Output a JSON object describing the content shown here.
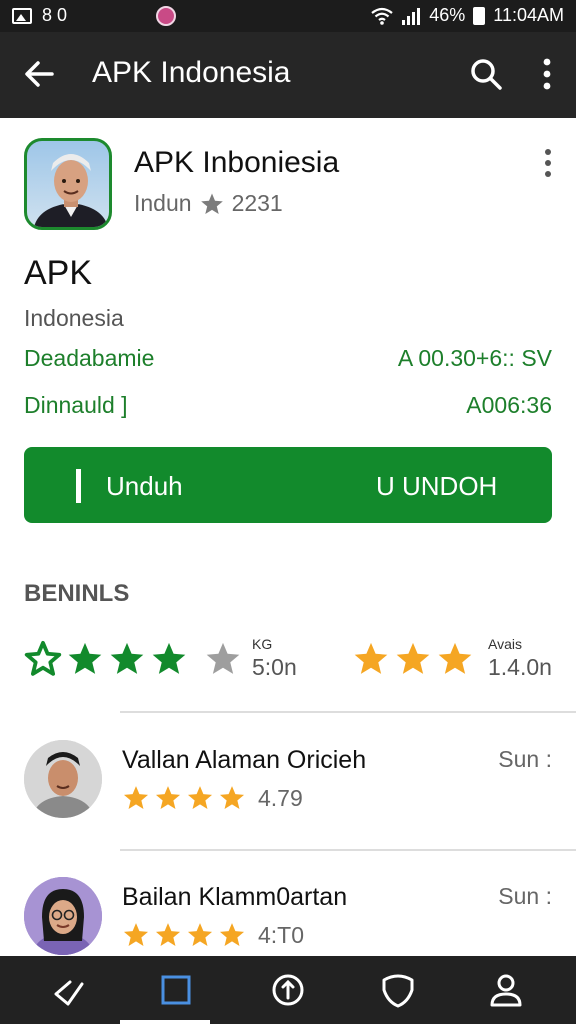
{
  "status_bar": {
    "left_text": "8 0",
    "battery": "46%",
    "time": "11:04AM"
  },
  "app_bar": {
    "title": "APK Indonesia"
  },
  "app": {
    "name": "APK Inboniesia",
    "meta_left": "Indun",
    "meta_right": "2231"
  },
  "heading": {
    "title": "APK",
    "subtitle": "Indonesia"
  },
  "info": [
    {
      "label": "Deadabamie",
      "value": "A 00.30+6:: SV"
    },
    {
      "label": "Dinnauld ]",
      "value": "A006:36"
    }
  ],
  "download_button": {
    "left_label": "Unduh",
    "right_label": "U UNDOH"
  },
  "section": {
    "title": "BENINLS"
  },
  "ratings": {
    "stat_a_small": "KG",
    "stat_a_big": "5:0n",
    "stat_b_small": "Avais",
    "stat_b_big": "1.4.0n"
  },
  "reviews": [
    {
      "name": "Vallan Alaman Oricieh",
      "score": "4.79",
      "date": "Sun :",
      "stars": 4
    },
    {
      "name": "Bailan Klamm0artan",
      "score": "4:T0",
      "date": "Sun :",
      "stars": 4
    }
  ],
  "colors": {
    "accent_green": "#128a2c",
    "star_gold": "#f5a623",
    "star_gray": "#9e9e9e",
    "dark_bar": "#262626"
  }
}
